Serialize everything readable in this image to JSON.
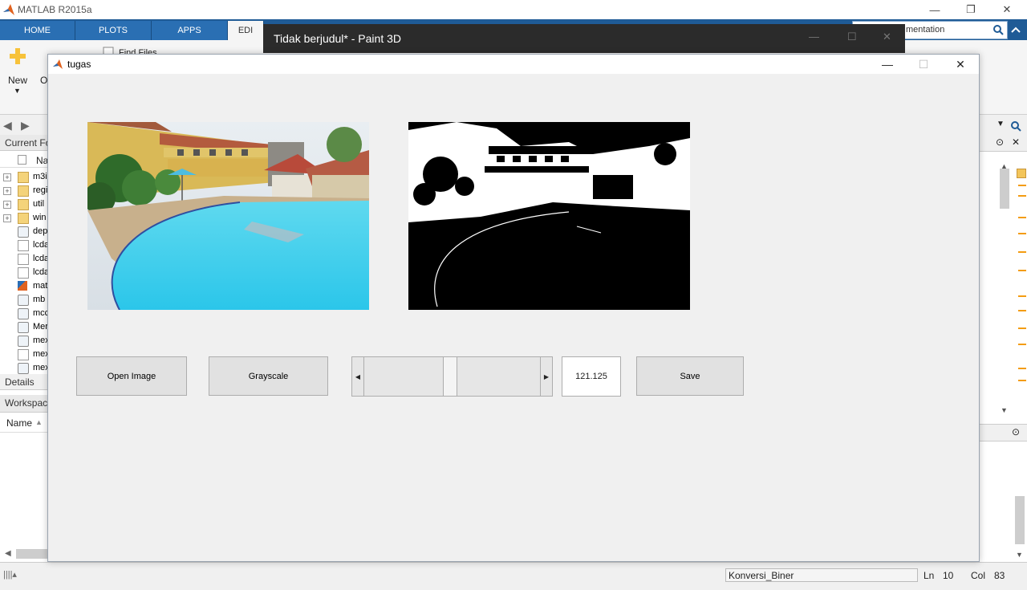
{
  "matlab": {
    "title": "MATLAB R2015a",
    "tabs": [
      "HOME",
      "PLOTS",
      "APPS",
      "EDI"
    ],
    "search_placeholder": "mentation",
    "ribbon": {
      "new_label": "New",
      "open_label": "Op",
      "find_files_label": "Find Files"
    },
    "current_folder_label": "Current Fo",
    "name_column": "Na",
    "files": [
      {
        "name": "m3i",
        "type": "folder"
      },
      {
        "name": "regi",
        "type": "folder"
      },
      {
        "name": "util",
        "type": "folder"
      },
      {
        "name": "win",
        "type": "folder"
      },
      {
        "name": "dep",
        "type": "mfile"
      },
      {
        "name": "lcda",
        "type": "file"
      },
      {
        "name": "lcda",
        "type": "file"
      },
      {
        "name": "lcda",
        "type": "file"
      },
      {
        "name": "mat",
        "type": "matlab"
      },
      {
        "name": "mb",
        "type": "mfile"
      },
      {
        "name": "mcc",
        "type": "mfile"
      },
      {
        "name": "Mer",
        "type": "mfile"
      },
      {
        "name": "mex",
        "type": "mfile"
      },
      {
        "name": "mex",
        "type": "file"
      },
      {
        "name": "mex",
        "type": "mfile"
      }
    ],
    "details_label": "Details",
    "workspace_label": "Workspac",
    "workspace_name_col": "Name",
    "status": {
      "function_name": "Konversi_Biner",
      "ln_label": "Ln",
      "ln_value": "10",
      "col_label": "Col",
      "col_value": "83"
    }
  },
  "paint3d": {
    "title": "Tidak berjudul* - Paint 3D"
  },
  "figure": {
    "title": "tugas",
    "buttons": {
      "open_image": "Open Image",
      "grayscale": "Grayscale",
      "save": "Save"
    },
    "slider_value": "121.125",
    "slider_level": 0.49
  },
  "colors": {
    "matlab_blue": "#1f5b96",
    "orange_marker": "#f39c12"
  }
}
